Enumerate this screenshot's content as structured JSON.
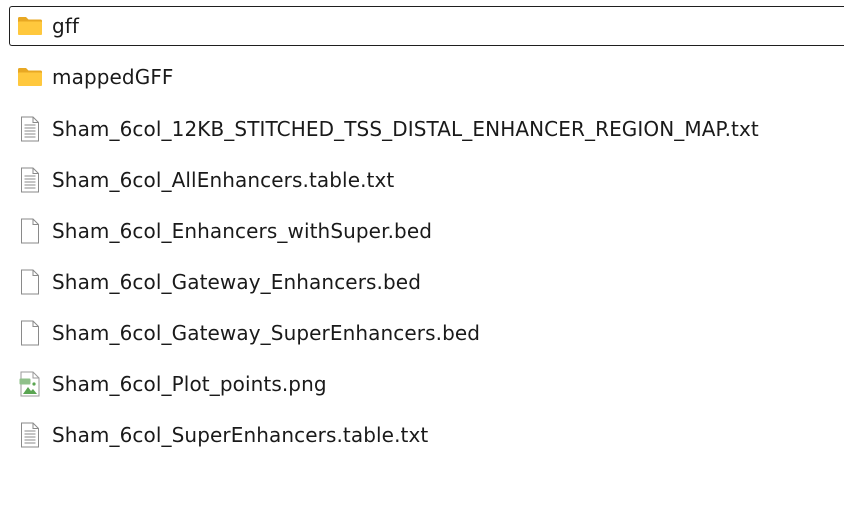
{
  "items": [
    {
      "name": "gff",
      "type": "folder",
      "icon": "folder-icon",
      "selected": true
    },
    {
      "name": "mappedGFF",
      "type": "folder",
      "icon": "folder-icon",
      "selected": false
    },
    {
      "name": "Sham_6col_12KB_STITCHED_TSS_DISTAL_ENHANCER_REGION_MAP.txt",
      "type": "text",
      "icon": "text-file-icon",
      "selected": false
    },
    {
      "name": "Sham_6col_AllEnhancers.table.txt",
      "type": "text",
      "icon": "text-file-icon",
      "selected": false
    },
    {
      "name": "Sham_6col_Enhancers_withSuper.bed",
      "type": "blank",
      "icon": "blank-file-icon",
      "selected": false
    },
    {
      "name": "Sham_6col_Gateway_Enhancers.bed",
      "type": "blank",
      "icon": "blank-file-icon",
      "selected": false
    },
    {
      "name": "Sham_6col_Gateway_SuperEnhancers.bed",
      "type": "blank",
      "icon": "blank-file-icon",
      "selected": false
    },
    {
      "name": "Sham_6col_Plot_points.png",
      "type": "image",
      "icon": "image-file-icon",
      "selected": false
    },
    {
      "name": "Sham_6col_SuperEnhancers.table.txt",
      "type": "text",
      "icon": "text-file-icon",
      "selected": false
    }
  ],
  "colors": {
    "folder_back": "#E8A823",
    "folder_front": "#FFC83D",
    "file_border": "#8a8a8a",
    "image_green": "#5aa552"
  }
}
